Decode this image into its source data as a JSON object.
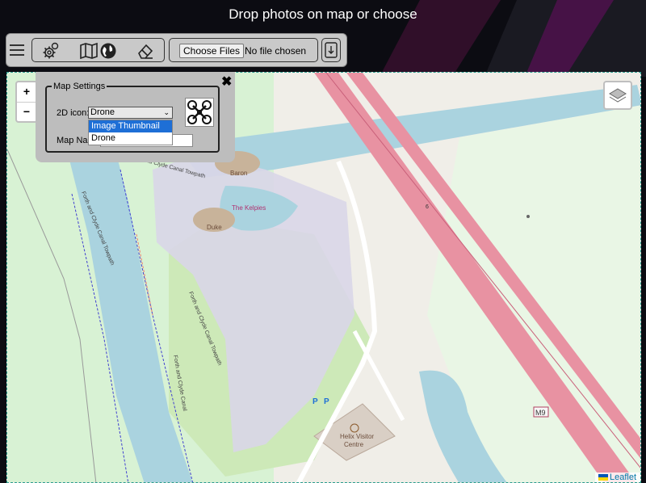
{
  "page": {
    "title": "Drop photos on map or choose"
  },
  "toolbar": {
    "menu_icon": "hamburger-icon",
    "tools": [
      "gear-icon",
      "map-icon",
      "globe-icon",
      "eraser-icon"
    ],
    "choose_files_label": "Choose Files",
    "file_status": "No file chosen",
    "download_icon": "download-icon"
  },
  "map": {
    "zoom_in": "+",
    "zoom_out": "−",
    "layers_icon": "layers-icon",
    "attribution": "Leaflet",
    "labels": {
      "baron": "Baron",
      "kelpies": "The Kelpies",
      "duke": "Duke",
      "towpath_1": "Forth and Clyde Canal Towpath",
      "towpath_2": "Forth and Clyde Canal Towpath",
      "towpath_3": "Forth and Clyde Canal Towpath",
      "canal": "Forth and Clyde Canal",
      "visitor_centre_1": "Helix Visitor",
      "visitor_centre_2": "Centre",
      "road_m9": "M9",
      "road_6": "6"
    }
  },
  "settings": {
    "legend": "Map Settings",
    "close": "✖",
    "icon_label": "2D icon:",
    "icon_selected": "Drone",
    "icon_options": [
      "Image Thumbnail",
      "Drone"
    ],
    "map_name_label": "Map Name",
    "map_name_value": "",
    "preview_icon": "drone-icon"
  },
  "colors": {
    "motorway": "#e892a2",
    "canal": "#aad3df",
    "park": "#c8facc",
    "highlight": "#1e6fd6"
  }
}
